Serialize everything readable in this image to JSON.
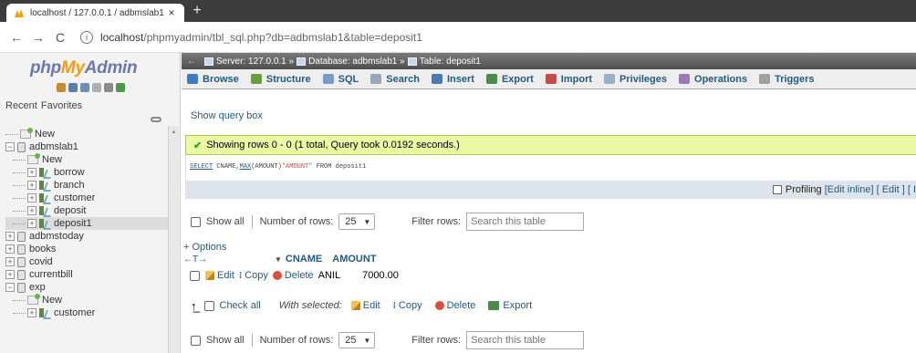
{
  "browser": {
    "tab_title": "localhost / 127.0.0.1 / adbmslab1 |",
    "url_host": "localhost",
    "url_path": "/phpmyadmin/tbl_sql.php?db=adbmslab1&table=deposit1"
  },
  "sidebar": {
    "logo_php": "php",
    "logo_my": "My",
    "logo_admin": "Admin",
    "recent_label": "Recent",
    "favorites_label": "Favorites",
    "tree": [
      {
        "label": "New",
        "type": "new",
        "level": 0
      },
      {
        "label": "adbmslab1",
        "type": "db",
        "level": 0,
        "expander": "−"
      },
      {
        "label": "New",
        "type": "new",
        "level": 1
      },
      {
        "label": "borrow",
        "type": "table",
        "level": 1,
        "expander": "+"
      },
      {
        "label": "branch",
        "type": "table",
        "level": 1,
        "expander": "+"
      },
      {
        "label": "customer",
        "type": "table",
        "level": 1,
        "expander": "+"
      },
      {
        "label": "deposit",
        "type": "table",
        "level": 1,
        "expander": "+"
      },
      {
        "label": "deposit1",
        "type": "table",
        "level": 1,
        "expander": "+",
        "selected": true
      },
      {
        "label": "adbmstoday",
        "type": "db",
        "level": 0,
        "expander": "+"
      },
      {
        "label": "books",
        "type": "db",
        "level": 0,
        "expander": "+"
      },
      {
        "label": "covid",
        "type": "db",
        "level": 0,
        "expander": "+"
      },
      {
        "label": "currentbill",
        "type": "db",
        "level": 0,
        "expander": "+"
      },
      {
        "label": "exp",
        "type": "db",
        "level": 0,
        "expander": "−"
      },
      {
        "label": "New",
        "type": "new",
        "level": 1
      },
      {
        "label": "customer",
        "type": "table",
        "level": 1,
        "expander": "+"
      }
    ]
  },
  "breadcrumb": {
    "server": "Server: 127.0.0.1",
    "database": "Database: adbmslab1",
    "table": "Table: deposit1"
  },
  "tabs": [
    {
      "label": "Browse",
      "icon": "#3f7bbf"
    },
    {
      "label": "Structure",
      "icon": "#6b9e3a"
    },
    {
      "label": "SQL",
      "icon": "#7a9cc6"
    },
    {
      "label": "Search",
      "icon": "#9aa7b8"
    },
    {
      "label": "Insert",
      "icon": "#4a7ab0"
    },
    {
      "label": "Export",
      "icon": "#4a8a4a"
    },
    {
      "label": "Import",
      "icon": "#c24b4b"
    },
    {
      "label": "Privileges",
      "icon": "#9bb0c8"
    },
    {
      "label": "Operations",
      "icon": "#9a7ab5"
    },
    {
      "label": "Triggers",
      "icon": "#a0a0a0"
    }
  ],
  "query": {
    "show_query_box": "Show query box",
    "success_message": "Showing rows 0 - 0 (1 total, Query took 0.0192 seconds.)",
    "sql_kw1": "SELECT",
    "sql_part1": " CNAME,",
    "sql_kw2": "MAX",
    "sql_part2": "(AMOUNT)",
    "sql_str": "\"AMOUNT\"",
    "sql_part3": " FROM deposit1"
  },
  "profiling": {
    "label": "Profiling",
    "edit_inline": "[Edit inline]",
    "edit": "[ Edit ]",
    "extra": "[ I"
  },
  "navigation": {
    "show_all": "Show all",
    "rows_label": "Number of rows:",
    "rows_value": "25",
    "filter_label": "Filter rows:",
    "filter_placeholder": "Search this table"
  },
  "results": {
    "options_label": "+ Options",
    "arrows": "←T→",
    "sort_icon": "▼",
    "columns": [
      "CNAME",
      "AMOUNT"
    ],
    "row_actions": {
      "edit": "Edit",
      "copy": "Copy",
      "delete": "Delete"
    },
    "rows": [
      {
        "CNAME": "ANIL",
        "AMOUNT": "7000.00"
      }
    ]
  },
  "bulk": {
    "check_all": "Check all",
    "with_selected": "With selected:",
    "edit": "Edit",
    "copy": "Copy",
    "delete": "Delete",
    "export": "Export"
  }
}
